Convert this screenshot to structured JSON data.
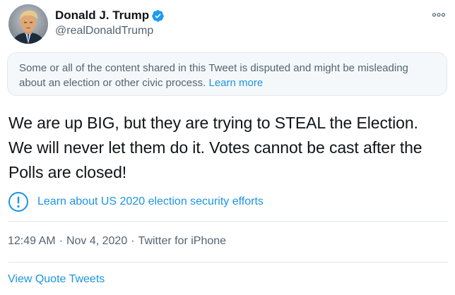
{
  "author": {
    "display_name": "Donald J. Trump",
    "handle": "@realDonaldTrump",
    "verified": true,
    "avatar_icon": "profile-photo"
  },
  "notice": {
    "text": "Some or all of the content shared in this Tweet is disputed and might be misleading about an election or other civic process. ",
    "link_label": "Learn more"
  },
  "tweet": {
    "text": "We are up BIG, but they are trying to STEAL the Election. We will never let them do it. Votes cannot be cast after the Polls are closed!"
  },
  "learn_link": {
    "label": "Learn about US 2020 election security efforts",
    "icon": "alert-circle-icon"
  },
  "meta": {
    "time": "12:49 AM",
    "separator": "·",
    "date": "Nov 4, 2020",
    "source": "Twitter for iPhone"
  },
  "actions": {
    "quote_tweets_label": "View Quote Tweets"
  },
  "colors": {
    "link_blue": "#1b95e0",
    "verified_blue": "#1d9bf0",
    "text_primary": "#0f1419",
    "text_secondary": "#536471",
    "notice_bg": "#f5f8fa",
    "border": "#e1e8ed"
  }
}
